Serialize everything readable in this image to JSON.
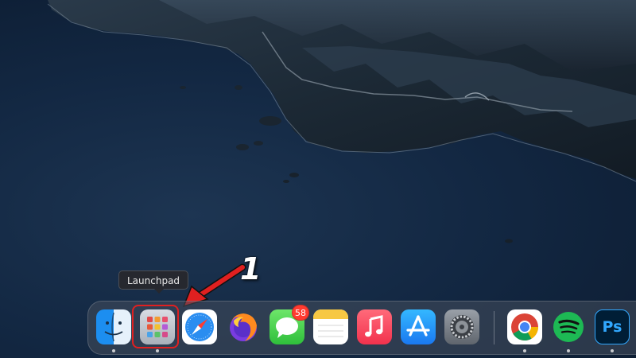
{
  "tooltip": {
    "text": "Launchpad"
  },
  "annotation": {
    "number": "1"
  },
  "dock": {
    "items": [
      {
        "name": "Finder",
        "icon": "finder-icon",
        "running": true
      },
      {
        "name": "Launchpad",
        "icon": "launchpad-icon",
        "running": true,
        "highlighted": true
      },
      {
        "name": "Safari",
        "icon": "safari-icon",
        "running": false
      },
      {
        "name": "Firefox",
        "icon": "firefox-icon",
        "running": false
      },
      {
        "name": "Messages",
        "icon": "messages-icon",
        "running": false,
        "badge": "58"
      },
      {
        "name": "Notes",
        "icon": "notes-icon",
        "running": false
      },
      {
        "name": "Music",
        "icon": "music-icon",
        "running": false
      },
      {
        "name": "App Store",
        "icon": "app-store-icon",
        "running": false
      },
      {
        "name": "System Preferences",
        "icon": "system-preferences-icon",
        "running": false
      },
      {
        "name": "Google Chrome",
        "icon": "chrome-icon",
        "running": true
      },
      {
        "name": "Spotify",
        "icon": "spotify-icon",
        "running": true
      },
      {
        "name": "Photoshop",
        "icon": "photoshop-icon",
        "running": true,
        "label": "Ps"
      }
    ]
  },
  "colors": {
    "highlight": "#e02020",
    "badge": "#ff3b30",
    "accent_spotify": "#1db954",
    "accent_photoshop": "#31a8ff"
  }
}
